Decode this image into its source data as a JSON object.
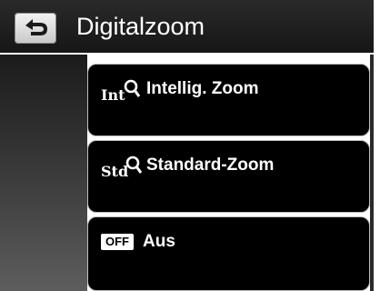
{
  "header": {
    "title": "Digitalzoom",
    "back_icon": "back-arrow-icon"
  },
  "menu": {
    "items": [
      {
        "label": "Intellig. Zoom",
        "icon": "int-zoom-icon",
        "icon_text": "Int"
      },
      {
        "label": "Standard-Zoom",
        "icon": "std-zoom-icon",
        "icon_text": "Std"
      },
      {
        "label": "Aus",
        "icon": "off-icon",
        "icon_text": "OFF"
      }
    ]
  },
  "colors": {
    "header_bg": "#1f1f1f",
    "item_bg": "#000000",
    "text": "#ffffff"
  }
}
